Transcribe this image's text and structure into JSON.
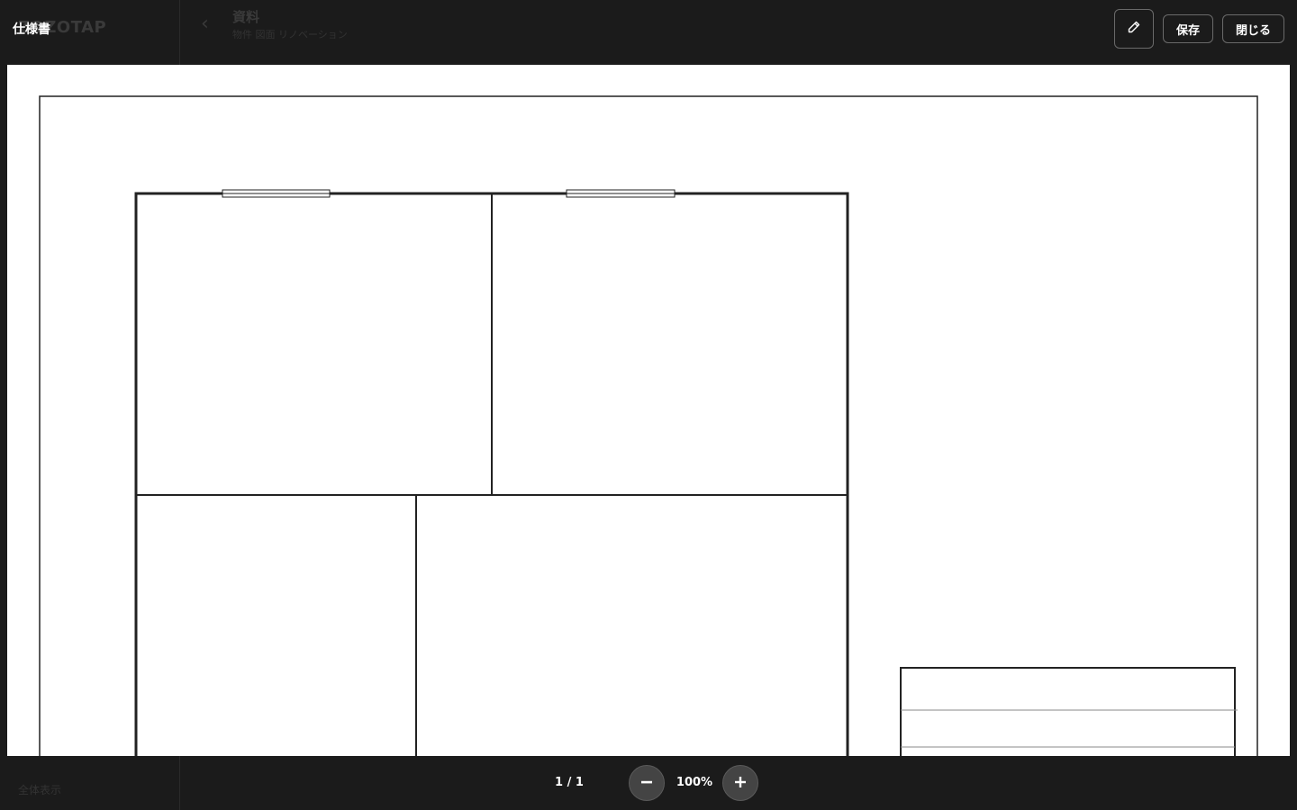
{
  "header": {
    "title": "仕様書",
    "edit_icon": "pencil-icon",
    "save_label": "保存",
    "close_label": "閉じる"
  },
  "background_app": {
    "logo": "ZOZOTAP",
    "back_icon": "chevron-left-icon",
    "page_title": "資料",
    "page_subtitle": "物件 図面 リノベーション",
    "footer_text": "全体表示"
  },
  "footer": {
    "page_indicator": "1 / 1",
    "zoom_level": "100%",
    "zoom_out_icon": "minus-icon",
    "zoom_in_icon": "plus-icon"
  },
  "colors": {
    "overlay_bg": "#1b1b1b",
    "document_bg": "#ffffff",
    "line": "#222222",
    "button_border": "#6a6a6a",
    "zoom_button_bg": "#444444"
  }
}
